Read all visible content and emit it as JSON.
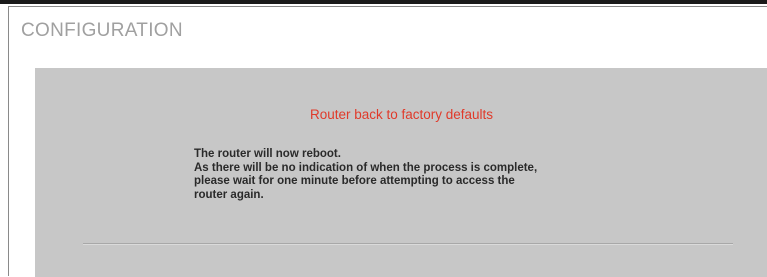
{
  "page": {
    "title": "CONFIGURATION"
  },
  "panel": {
    "heading": "Router back to factory defaults",
    "message_lines": [
      "The router will now reboot.",
      "As there will be no indication of when the process is complete,",
      "please wait for one minute before attempting to access the",
      "router again."
    ]
  },
  "colors": {
    "heading": "#e03a2a",
    "panel_background": "#c7c7c7",
    "title_text": "#a0a0a0"
  }
}
